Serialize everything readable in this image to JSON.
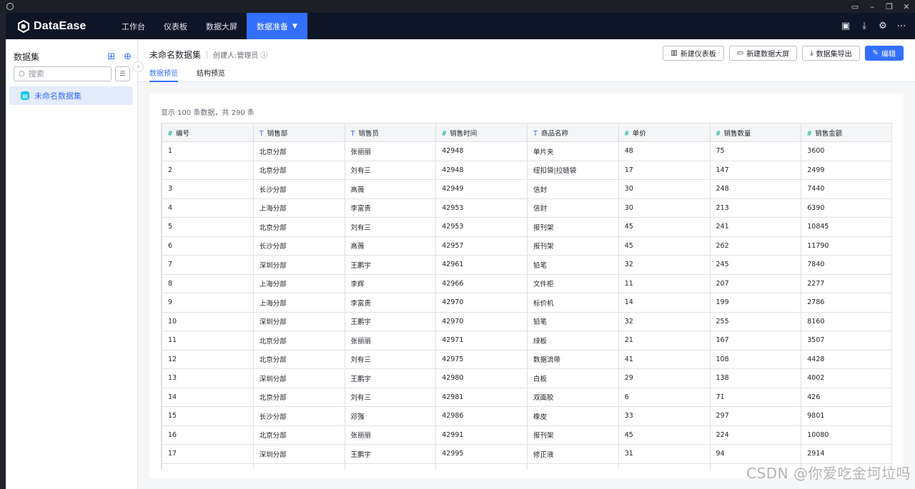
{
  "topnav": {
    "brand": "DataEase",
    "menu": [
      "工作台",
      "仪表板",
      "数据大屏",
      "数据准备"
    ],
    "active_menu": "数据准备",
    "tools": [
      "briefcase-icon",
      "download-icon",
      "settings-icon",
      "more-icon"
    ]
  },
  "sidebar": {
    "title": "数据集",
    "search_placeholder": "搜索",
    "items": [
      {
        "label": "未命名数据集",
        "selected": true
      }
    ]
  },
  "header": {
    "dataset_name": "未命名数据集",
    "creator": "创建人:管理员",
    "buttons": {
      "new_dashboard": "新建仪表板",
      "new_screen": "新建数据大屏",
      "export": "数据集导出",
      "edit": "编辑"
    },
    "tabs": [
      "数据预览",
      "结构预览"
    ],
    "active_tab": "数据预览"
  },
  "preview": {
    "summary": "显示 100 条数据，共 290 条",
    "columns": [
      {
        "name": "编号",
        "type": "number"
      },
      {
        "name": "销售部",
        "type": "text"
      },
      {
        "name": "销售员",
        "type": "text"
      },
      {
        "name": "销售时间",
        "type": "number"
      },
      {
        "name": "商品名称",
        "type": "text"
      },
      {
        "name": "单价",
        "type": "number"
      },
      {
        "name": "销售数量",
        "type": "number"
      },
      {
        "name": "销售金额",
        "type": "number"
      }
    ],
    "rows": [
      [
        "1",
        "北京分部",
        "张丽丽",
        "42948",
        "单片夹",
        "48",
        "75",
        "3600"
      ],
      [
        "2",
        "北京分部",
        "刘有三",
        "42948",
        "纽扣袋|拉链袋",
        "17",
        "147",
        "2499"
      ],
      [
        "3",
        "长沙分部",
        "高薇",
        "42949",
        "信封",
        "30",
        "248",
        "7440"
      ],
      [
        "4",
        "上海分部",
        "李富贵",
        "42953",
        "信封",
        "30",
        "213",
        "6390"
      ],
      [
        "5",
        "北京分部",
        "刘有三",
        "42953",
        "报刊架",
        "45",
        "241",
        "10845"
      ],
      [
        "6",
        "长沙分部",
        "高薇",
        "42957",
        "报刊架",
        "45",
        "262",
        "11790"
      ],
      [
        "7",
        "深圳分部",
        "王鹏宇",
        "42961",
        "铅笔",
        "32",
        "245",
        "7840"
      ],
      [
        "8",
        "上海分部",
        "李辉",
        "42966",
        "文件柜",
        "11",
        "207",
        "2277"
      ],
      [
        "9",
        "上海分部",
        "李富贵",
        "42970",
        "标价机",
        "14",
        "199",
        "2786"
      ],
      [
        "10",
        "深圳分部",
        "王鹏宇",
        "42970",
        "铅笔",
        "32",
        "255",
        "8160"
      ],
      [
        "11",
        "北京分部",
        "张丽丽",
        "42971",
        "绿板",
        "21",
        "167",
        "3507"
      ],
      [
        "12",
        "北京分部",
        "刘有三",
        "42975",
        "数据流带",
        "41",
        "108",
        "4428"
      ],
      [
        "13",
        "深圳分部",
        "王鹏宇",
        "42980",
        "白板",
        "29",
        "138",
        "4002"
      ],
      [
        "14",
        "北京分部",
        "刘有三",
        "42981",
        "双面胶",
        "6",
        "71",
        "426"
      ],
      [
        "15",
        "长沙分部",
        "邓强",
        "42986",
        "橡皮",
        "33",
        "297",
        "9801"
      ],
      [
        "16",
        "北京分部",
        "张丽丽",
        "42991",
        "报刊架",
        "45",
        "224",
        "10080"
      ],
      [
        "17",
        "深圳分部",
        "王鹏宇",
        "42995",
        "修正液",
        "31",
        "94",
        "2914"
      ],
      [
        "",
        "",
        "",
        "",
        "",
        "",
        "",
        ""
      ]
    ]
  },
  "watermark": "CSDN @你爱吃金坷垃吗",
  "colors": {
    "accent": "#3370ff",
    "nav_bg": "#0e1526",
    "number_type": "#04b49c"
  }
}
